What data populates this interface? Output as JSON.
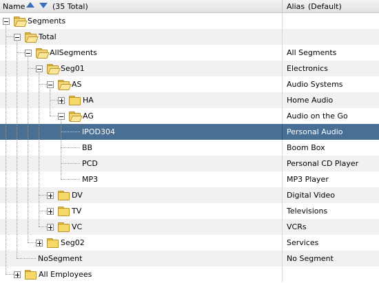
{
  "header": {
    "name_label": "Name",
    "total_label": "(35 Total)",
    "alias_label": "Alias",
    "alias_default": "(Default)"
  },
  "rows": [
    {
      "label": "Segments",
      "alias": ""
    },
    {
      "label": "Total",
      "alias": ""
    },
    {
      "label": "AllSegments",
      "alias": "All Segments"
    },
    {
      "label": "Seg01",
      "alias": "Electronics"
    },
    {
      "label": "AS",
      "alias": "Audio Systems"
    },
    {
      "label": "HA",
      "alias": "Home Audio"
    },
    {
      "label": "AG",
      "alias": "Audio on the Go"
    },
    {
      "label": "IPOD304",
      "alias": "Personal Audio"
    },
    {
      "label": "BB",
      "alias": "Boom Box"
    },
    {
      "label": "PCD",
      "alias": "Personal CD Player"
    },
    {
      "label": "MP3",
      "alias": "MP3 Player"
    },
    {
      "label": "DV",
      "alias": "Digital Video"
    },
    {
      "label": "TV",
      "alias": "Televisions"
    },
    {
      "label": "VC",
      "alias": "VCRs"
    },
    {
      "label": "Seg02",
      "alias": "Services"
    },
    {
      "label": "NoSegment",
      "alias": "No Segment"
    },
    {
      "label": "All Employees",
      "alias": ""
    }
  ],
  "colors": {
    "selection": "#4a6f95",
    "alt_row": "#f1f1f1",
    "sort_arrow": "#3a6fc0",
    "folder": "#f7d866"
  }
}
